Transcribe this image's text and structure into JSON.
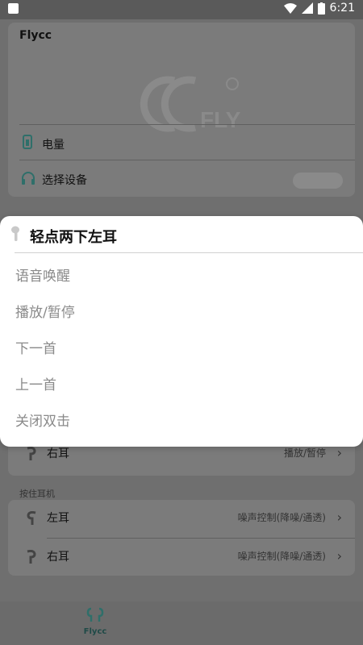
{
  "status_bar": {
    "time": "6:21"
  },
  "device_card": {
    "title": "Flycc",
    "battery_label": "电量",
    "select_device_label": "选择设备"
  },
  "dialog": {
    "title": "轻点两下左耳",
    "options": [
      "语音唤醒",
      "播放/暂停",
      "下一首",
      "上一首",
      "关闭双击"
    ]
  },
  "double_tap_section": {
    "right": {
      "label": "右耳",
      "value": "播放/暂停"
    }
  },
  "press_hold_section": {
    "title": "按住耳机",
    "left": {
      "label": "左耳",
      "value": "噪声控制(降噪/通透)"
    },
    "right": {
      "label": "右耳",
      "value": "噪声控制(降噪/通透)"
    }
  },
  "bottom_nav": {
    "item_label": "Flycc"
  },
  "colors": {
    "accent": "#2f6f6a",
    "overlay": "#6f6f6f"
  }
}
